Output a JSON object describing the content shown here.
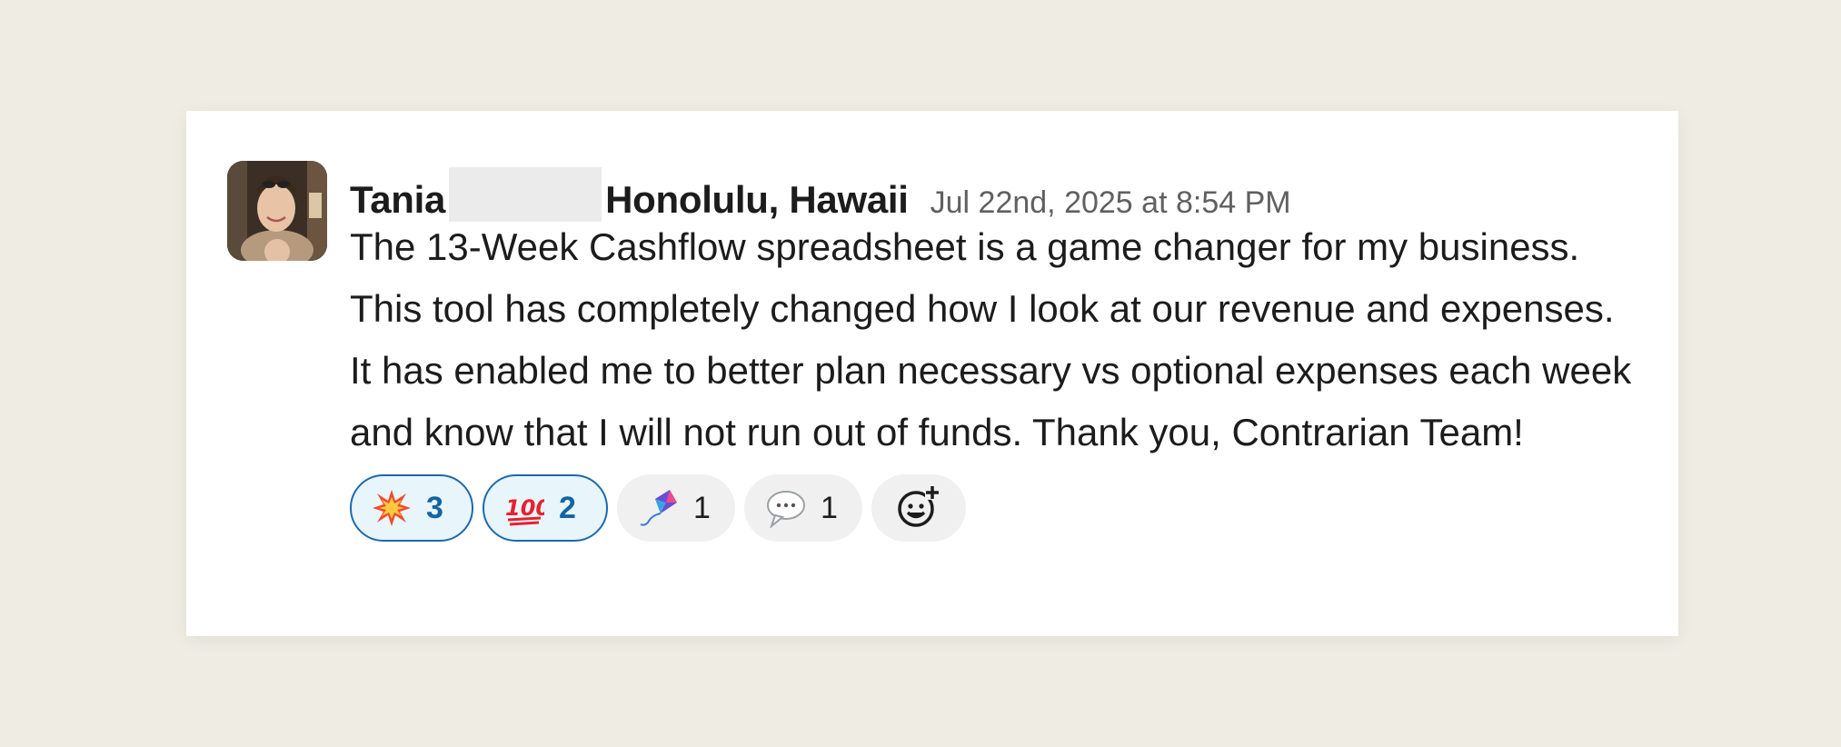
{
  "message": {
    "author": "Tania",
    "location": "Honolulu, Hawaii",
    "timestamp": "Jul 22nd, 2025 at 8:54 PM",
    "body": "The 13-Week Cashflow spreadsheet is a game changer for my business.  This tool has completely changed how I look at our revenue and expenses.  It has enabled me to better plan necessary vs optional expenses each week and know that I will not run out of funds.  Thank you, Contrarian Team!"
  },
  "reactions": [
    {
      "icon": "collision-icon",
      "count": "3",
      "active": true
    },
    {
      "icon": "hundred-points-icon",
      "count": "2",
      "active": true
    },
    {
      "icon": "kite-icon",
      "count": "1",
      "active": false
    },
    {
      "icon": "speech-bubble-icon",
      "count": "1",
      "active": false
    }
  ],
  "add_reaction": {
    "icon": "add-reaction-icon"
  },
  "colors": {
    "background": "#efece4",
    "card": "#ffffff",
    "active_border": "#1d6aab",
    "active_fill": "#e8f5fa",
    "text": "#1d1c1d",
    "muted": "#616061"
  }
}
